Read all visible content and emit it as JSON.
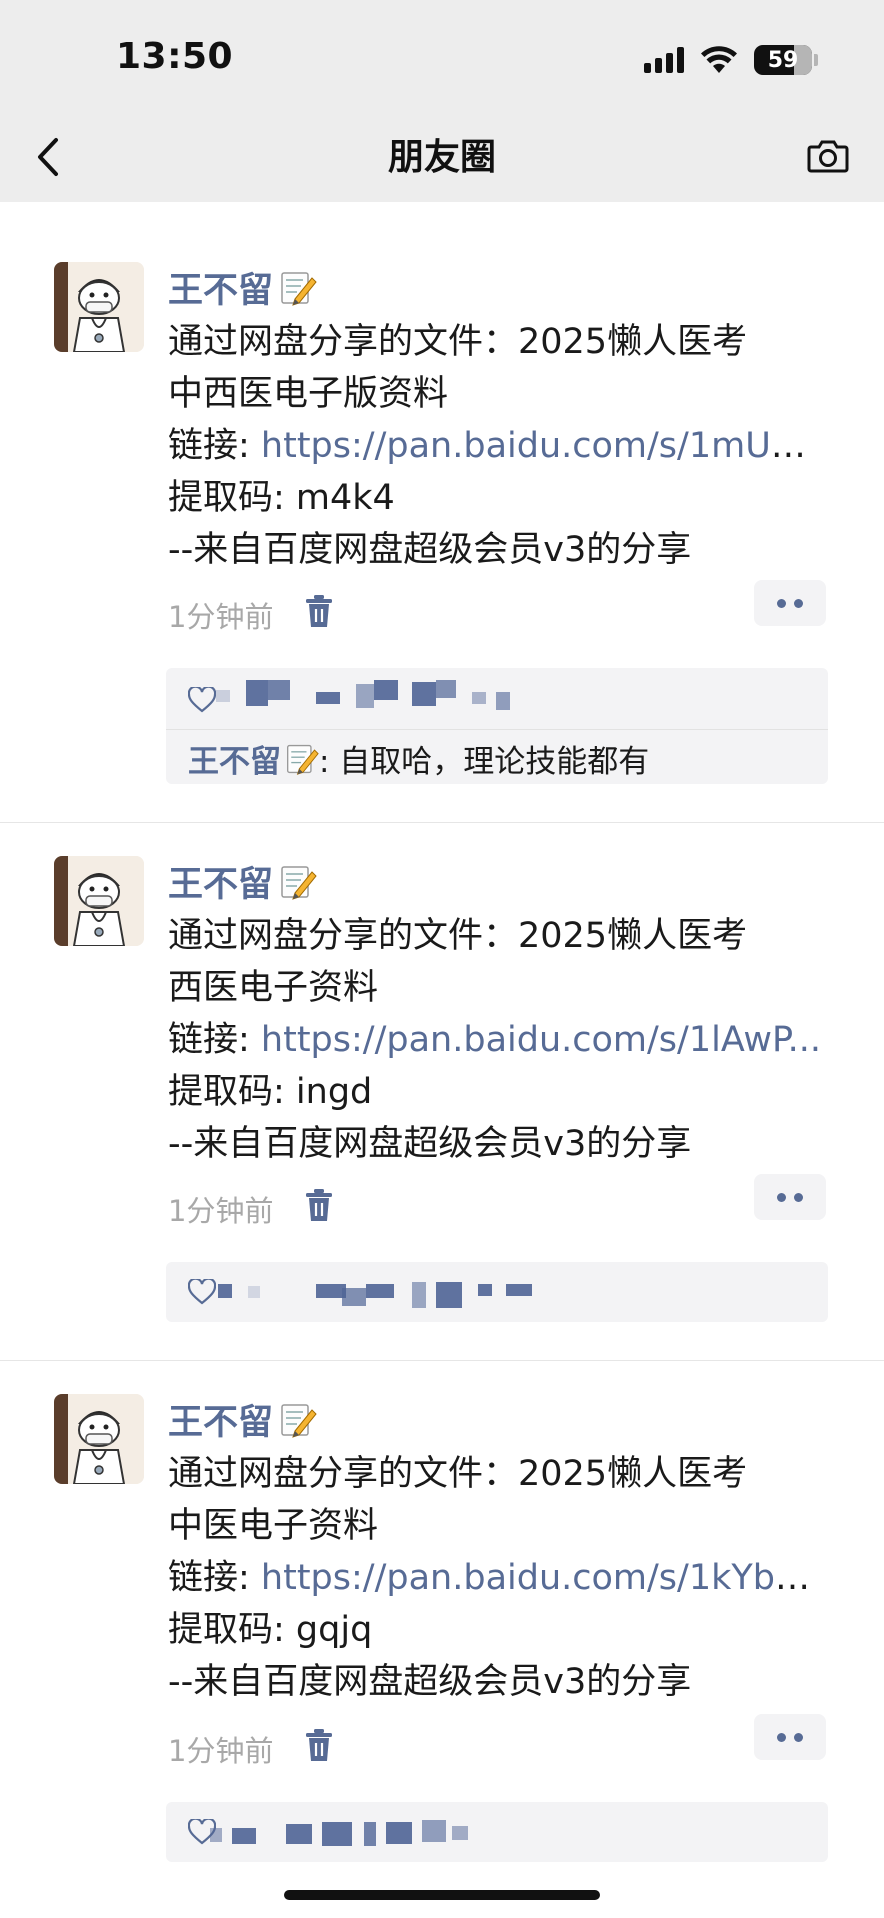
{
  "status_bar": {
    "time": "13:50",
    "battery": "59"
  },
  "nav": {
    "title": "朋友圈",
    "back_icon": "chevron-left-icon",
    "camera_icon": "camera-icon"
  },
  "colors": {
    "link": "#576b95",
    "background": "#ffffff",
    "topbar": "#ededed",
    "meta": "#a8a8a8"
  },
  "posts": [
    {
      "author": "王不留",
      "author_emoji": "memo-icon",
      "lines": [
        "通过网盘分享的文件：2025懒人医考",
        "中西医电子版资料"
      ],
      "link_label": "链接: ",
      "link_url": "https://pan.baidu.com/s/1mU6s...",
      "code_line": "提取码: m4k4",
      "source_line": "--来自百度网盘超级会员v3的分享",
      "time": "1分钟前",
      "comment_author": "王不留",
      "comment_text": ": 自取哈，理论技能都有"
    },
    {
      "author": "王不留",
      "author_emoji": "memo-icon",
      "lines": [
        "通过网盘分享的文件：2025懒人医考",
        "西医电子资料"
      ],
      "link_label": "链接: ",
      "link_url": "https://pan.baidu.com/s/1lAwP...",
      "code_line": "提取码: ingd",
      "source_line": "--来自百度网盘超级会员v3的分享",
      "time": "1分钟前"
    },
    {
      "author": "王不留",
      "author_emoji": "memo-icon",
      "lines": [
        "通过网盘分享的文件：2025懒人医考",
        "中医电子资料"
      ],
      "link_label": "链接: ",
      "link_url": "https://pan.baidu.com/s/1kYbQ...",
      "code_line": "提取码: gqjq",
      "source_line": "--来自百度网盘超级会员v3的分享",
      "time": "1分钟前"
    }
  ]
}
